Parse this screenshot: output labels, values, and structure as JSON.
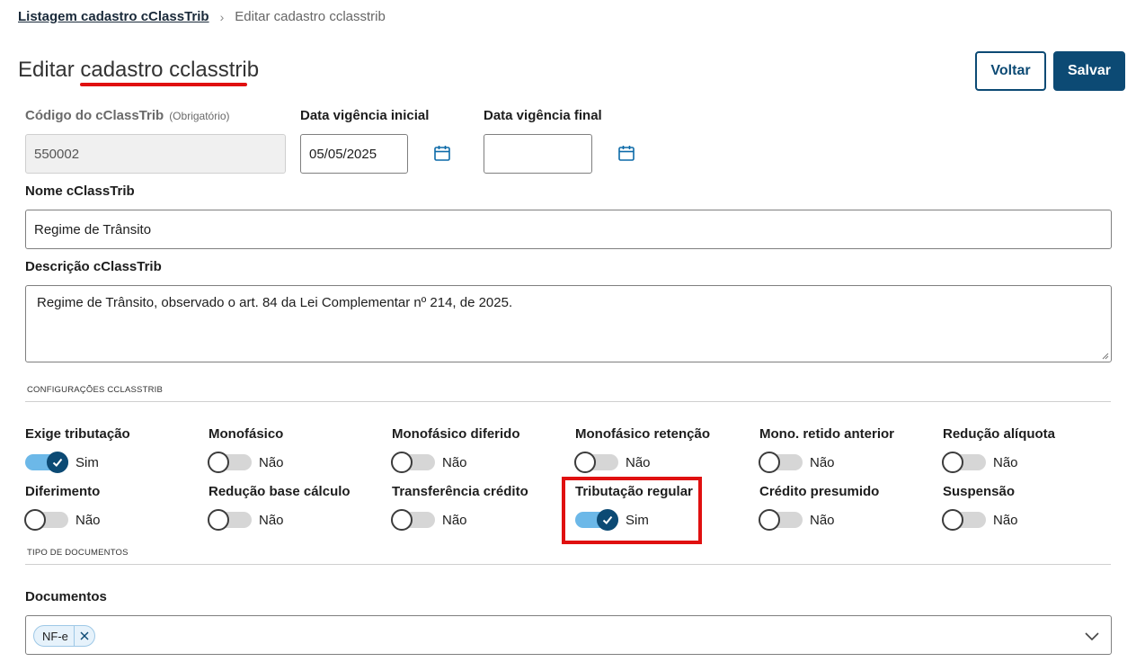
{
  "breadcrumb": {
    "parent": "Listagem cadastro cClassTrib",
    "separator": "›",
    "current": "Editar cadastro cclasstrib"
  },
  "page_title": "Editar cadastro cclasstrib",
  "buttons": {
    "back": "Voltar",
    "save": "Salvar"
  },
  "fields": {
    "codigo_label": "Código do cClassTrib",
    "codigo_hint": "(Obrigatório)",
    "codigo_value": "550002",
    "vigencia_inicial_label": "Data vigência inicial",
    "vigencia_inicial_value": "05/05/2025",
    "vigencia_final_label": "Data vigência final",
    "vigencia_final_value": "",
    "nome_label": "Nome cClassTrib",
    "nome_value": "Regime de Trânsito",
    "descricao_label": "Descrição cClassTrib",
    "descricao_value": "Regime de Trânsito, observado o art. 84 da Lei Complementar nº 214, de 2025."
  },
  "config_section": "CONFIGURAÇÕES CCLASSTRIB",
  "toggles_row1": [
    {
      "label": "Exige tributação",
      "on": true,
      "text": "Sim"
    },
    {
      "label": "Monofásico",
      "on": false,
      "text": "Não"
    },
    {
      "label": "Monofásico diferido",
      "on": false,
      "text": "Não"
    },
    {
      "label": "Monofásico retenção",
      "on": false,
      "text": "Não"
    },
    {
      "label": "Mono. retido anterior",
      "on": false,
      "text": "Não"
    },
    {
      "label": "Redução alíquota",
      "on": false,
      "text": "Não"
    }
  ],
  "toggles_row2": [
    {
      "label": "Diferimento",
      "on": false,
      "text": "Não"
    },
    {
      "label": "Redução base cálculo",
      "on": false,
      "text": "Não"
    },
    {
      "label": "Transferência crédito",
      "on": false,
      "text": "Não"
    },
    {
      "label": "Tributação regular",
      "on": true,
      "text": "Sim"
    },
    {
      "label": "Crédito presumido",
      "on": false,
      "text": "Não"
    },
    {
      "label": "Suspensão",
      "on": false,
      "text": "Não"
    }
  ],
  "documents_section": "TIPO DE DOCUMENTOS",
  "documents_label": "Documentos",
  "documents_selected": [
    "NF-e"
  ],
  "colors": {
    "primary": "#0c4a74",
    "toggle_on": "#6cb8e8",
    "annotation": "#e01010"
  },
  "icons": [
    "chevron-right-icon",
    "calendar-icon",
    "check-icon",
    "close-icon",
    "chevron-down-icon"
  ]
}
